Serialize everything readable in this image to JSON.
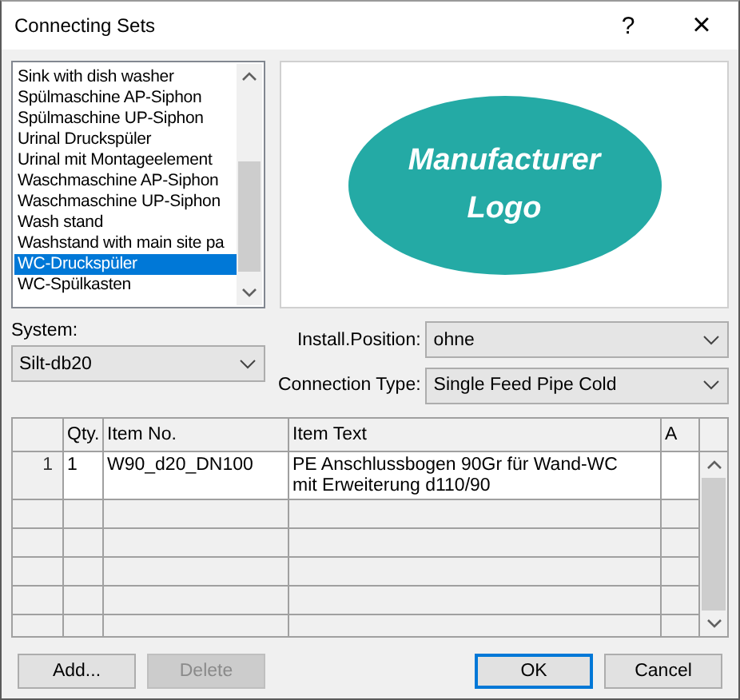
{
  "window": {
    "title": "Connecting Sets",
    "help": "?",
    "close": "×"
  },
  "connecting_sets": {
    "items": [
      {
        "label": "Sink with dish washer",
        "selected": false
      },
      {
        "label": "Spülmaschine AP-Siphon",
        "selected": false
      },
      {
        "label": "Spülmaschine UP-Siphon",
        "selected": false
      },
      {
        "label": "Urinal Druckspüler",
        "selected": false
      },
      {
        "label": "Urinal mit Montageelement",
        "selected": false
      },
      {
        "label": "Waschmaschine AP-Siphon",
        "selected": false
      },
      {
        "label": "Waschmaschine UP-Siphon",
        "selected": false
      },
      {
        "label": "Wash stand",
        "selected": false
      },
      {
        "label": "Washstand with main site pa",
        "selected": false
      },
      {
        "label": "WC-Druckspüler",
        "selected": true
      },
      {
        "label": "WC-Spülkasten",
        "selected": false
      }
    ]
  },
  "logo": {
    "lines": [
      "Manufacturer",
      "Logo"
    ]
  },
  "system": {
    "label": "System:",
    "value": "Silt-db20"
  },
  "install_position": {
    "label": "Install.Position:",
    "value": "ohne"
  },
  "connection_type": {
    "label": "Connection Type:",
    "value": "Single Feed Pipe Cold"
  },
  "table": {
    "columns": [
      {
        "label": "Qty."
      },
      {
        "label": "Item No."
      },
      {
        "label": "Item Text"
      },
      {
        "label": "A"
      }
    ],
    "rows": [
      {
        "number": "1",
        "qty": "1",
        "item_no": "W90_d20_DN100",
        "item_text": [
          "PE Anschlussbogen 90Gr für Wand-WC",
          "mit Erweiterung d110/90"
        ]
      }
    ]
  },
  "buttons": [
    {
      "label": "Add...",
      "disabled": false,
      "default": false
    },
    {
      "label": "Delete",
      "disabled": true,
      "default": false
    },
    {
      "label": "OK",
      "disabled": false,
      "default": true
    },
    {
      "label": "Cancel",
      "disabled": false,
      "default": false
    }
  ]
}
